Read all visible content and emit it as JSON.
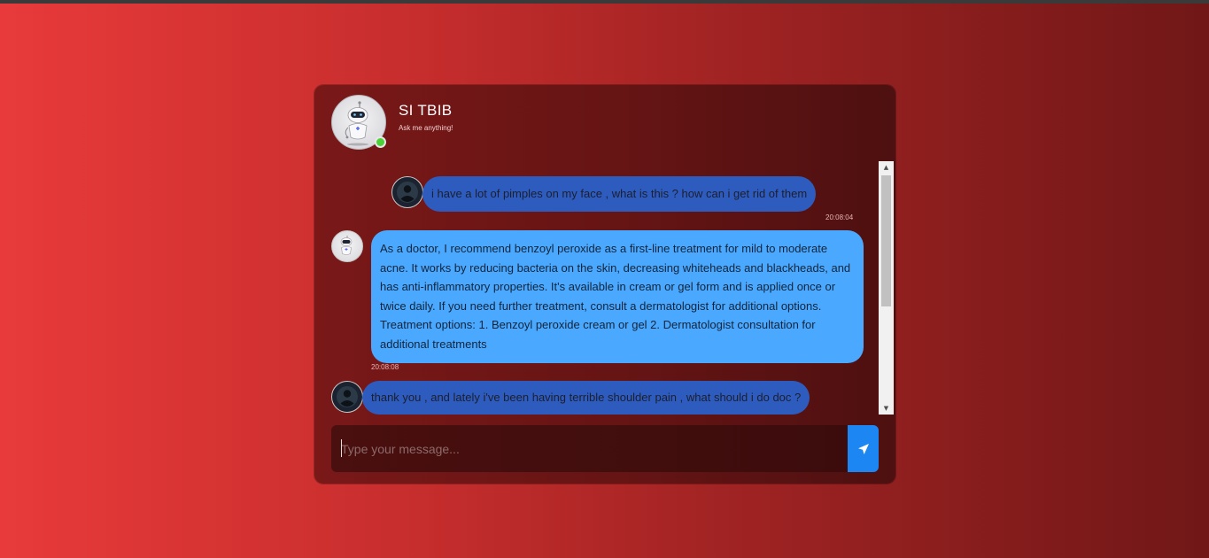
{
  "colors": {
    "page_gradient_start": "#e83a3a",
    "page_gradient_end": "#711717",
    "card": "#651414",
    "user_bubble": "#2e5cbe",
    "bot_bubble": "#4aa9ff",
    "send_button": "#1c86f2",
    "online_status": "#4cd137"
  },
  "header": {
    "title": "SI TBIB",
    "subtitle": "Ask me anything!",
    "avatar_icon": "robot-doctor-icon",
    "status_icon": "online-status-dot"
  },
  "messages": [
    {
      "sender": "user",
      "avatar_icon": "user-avatar-icon",
      "text": "i have a lot of pimples on my face , what is this ? how can i get rid of them",
      "time": "20:08:04"
    },
    {
      "sender": "bot",
      "avatar_icon": "robot-doctor-icon",
      "text": "As a doctor, I recommend benzoyl peroxide as a first-line treatment for mild to moderate acne. It works by reducing bacteria on the skin, decreasing whiteheads and blackheads, and has anti-inflammatory properties. It's available in cream or gel form and is applied once or twice daily. If you need further treatment, consult a dermatologist for additional options. Treatment options: 1. Benzoyl peroxide cream or gel 2. Dermatologist consultation for additional treatments",
      "time": "20:08:08"
    },
    {
      "sender": "user",
      "avatar_icon": "user-avatar-icon",
      "text": "thank you , and lately i've been having terrible shoulder pain , what should i do doc ?",
      "time": ""
    }
  ],
  "composer": {
    "placeholder": "Type your message...",
    "value": "",
    "send_icon": "send-arrow-icon"
  },
  "scrollbar": {
    "up_icon": "scroll-up-arrow-icon",
    "down_icon": "scroll-down-arrow-icon"
  }
}
